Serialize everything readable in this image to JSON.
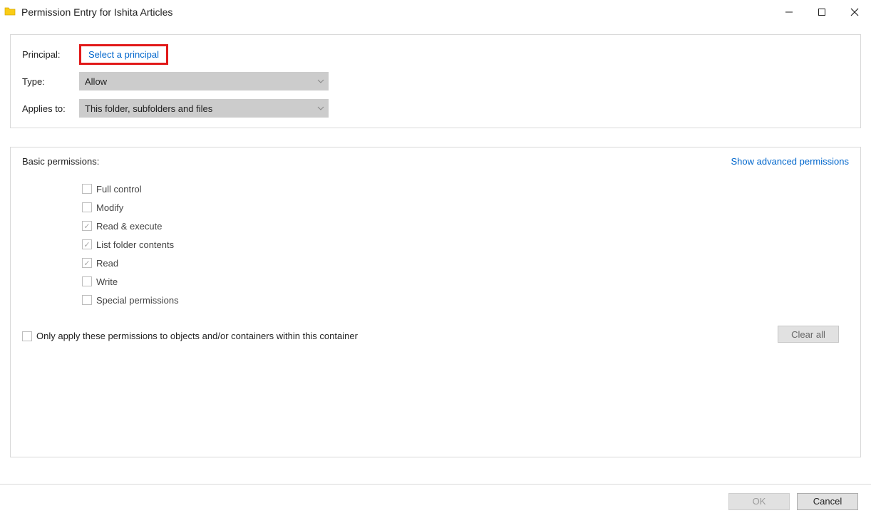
{
  "title": "Permission Entry for Ishita Articles",
  "top": {
    "principal_label": "Principal:",
    "select_principal": "Select a principal",
    "type_label": "Type:",
    "type_value": "Allow",
    "applies_label": "Applies to:",
    "applies_value": "This folder, subfolders and files"
  },
  "permissions": {
    "header": "Basic permissions:",
    "advanced_link": "Show advanced permissions",
    "items": [
      {
        "label": "Full control",
        "checked": false
      },
      {
        "label": "Modify",
        "checked": false
      },
      {
        "label": "Read & execute",
        "checked": true
      },
      {
        "label": "List folder contents",
        "checked": true
      },
      {
        "label": "Read",
        "checked": true
      },
      {
        "label": "Write",
        "checked": false
      },
      {
        "label": "Special permissions",
        "checked": false
      }
    ],
    "only_apply_label": "Only apply these permissions to objects and/or containers within this container",
    "clear_all_label": "Clear all"
  },
  "footer": {
    "ok": "OK",
    "cancel": "Cancel"
  }
}
